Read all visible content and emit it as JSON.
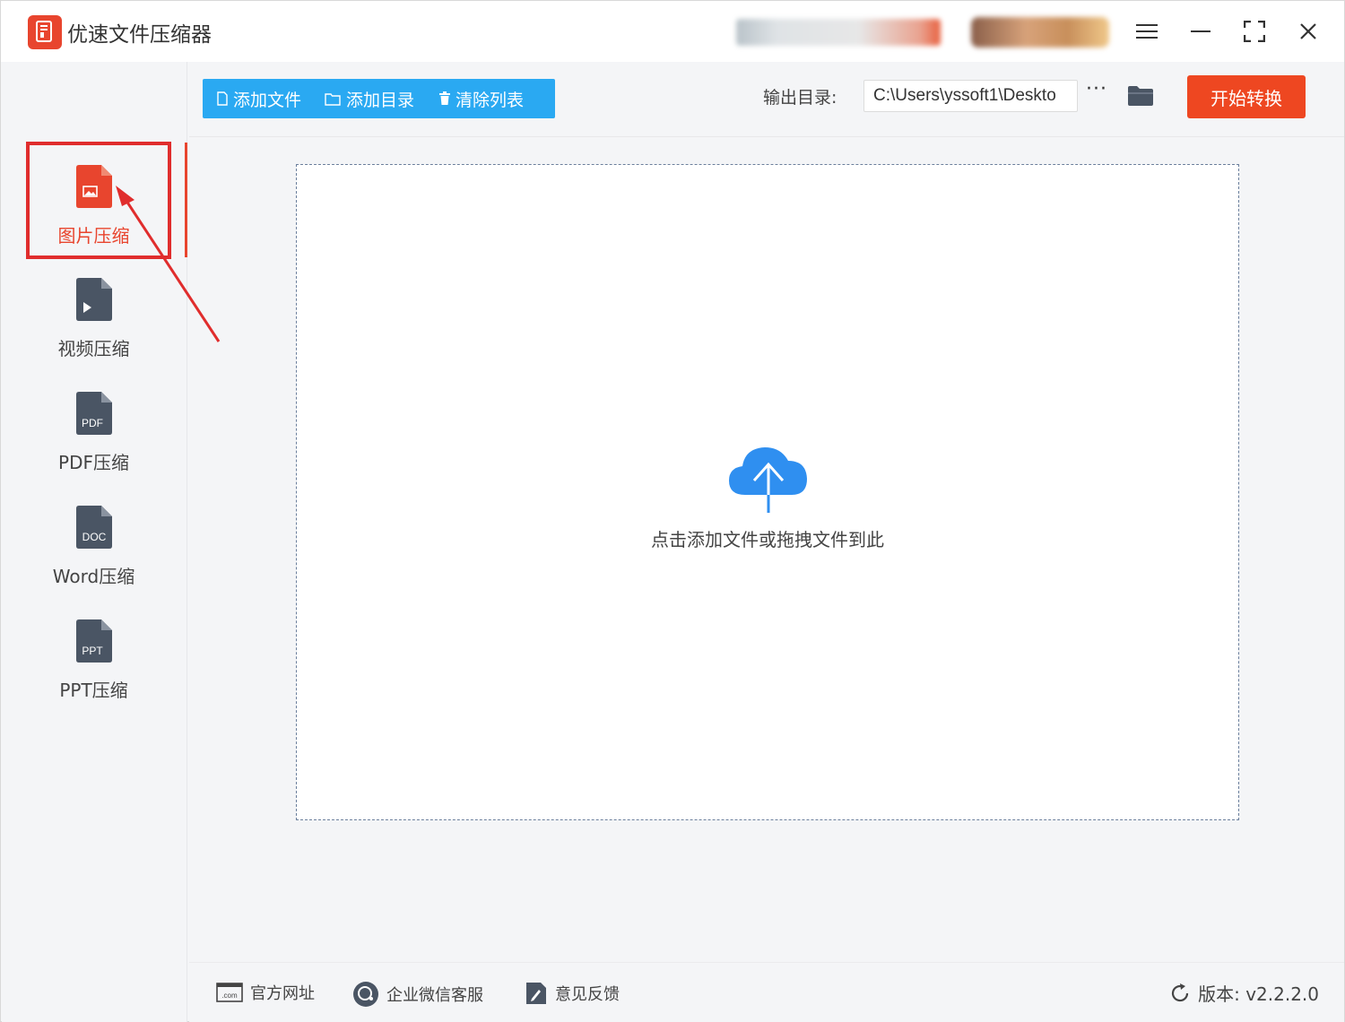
{
  "app": {
    "title": "优速文件压缩器"
  },
  "sidebar": {
    "items": [
      {
        "label": "图片压缩",
        "icon": "image-file-icon",
        "active": true
      },
      {
        "label": "视频压缩",
        "icon": "video-file-icon"
      },
      {
        "label": "PDF压缩",
        "icon": "pdf-file-icon",
        "badge": "PDF"
      },
      {
        "label": "Word压缩",
        "icon": "doc-file-icon",
        "badge": "DOC"
      },
      {
        "label": "PPT压缩",
        "icon": "ppt-file-icon",
        "badge": "PPT"
      }
    ]
  },
  "toolbar": {
    "add_file": "添加文件",
    "add_folder": "添加目录",
    "clear_list": "清除列表",
    "output_label": "输出目录:",
    "output_path": "C:\\Users\\yssoft1\\Deskto",
    "more": "···",
    "start": "开始转换"
  },
  "drop_zone": {
    "hint": "点击添加文件或拖拽文件到此"
  },
  "footer": {
    "website": "官方网址",
    "wechat": "企业微信客服",
    "feedback": "意见反馈",
    "version": "版本: v2.2.2.0"
  },
  "colors": {
    "accent_red": "#e8452e",
    "toolbar_blue": "#2aa9f2",
    "start_orange": "#ee4721",
    "annotation_red": "#e02d2d",
    "file_icon_gray": "#4a5564"
  }
}
